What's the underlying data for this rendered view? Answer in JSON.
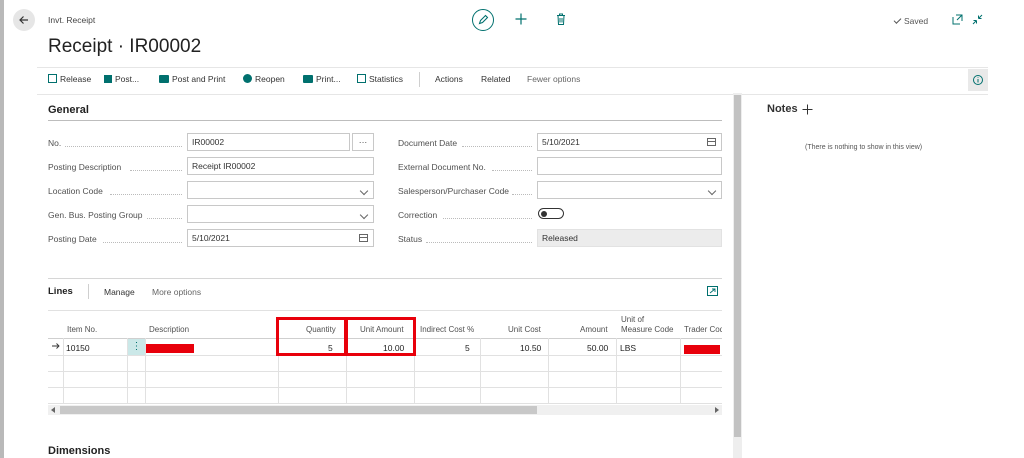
{
  "header": {
    "breadcrumb": "Invt. Receipt",
    "title": "Receipt · IR00002",
    "saved_label": "Saved"
  },
  "toolbar": {
    "items": [
      "Release",
      "Post...",
      "Post and Print",
      "Reopen",
      "Print...",
      "Statistics",
      "Actions",
      "Related",
      "Fewer options"
    ]
  },
  "general": {
    "title": "General",
    "no_label": "No.",
    "no_value": "IR00002",
    "posting_description_label": "Posting Description",
    "posting_description_value": "Receipt IR00002",
    "location_code_label": "Location Code",
    "location_code_value": "",
    "gen_bus_label": "Gen. Bus. Posting Group",
    "gen_bus_value": "",
    "posting_date_label": "Posting Date",
    "posting_date_value": "5/10/2021",
    "document_date_label": "Document Date",
    "document_date_value": "5/10/2021",
    "external_doc_label": "External Document No.",
    "external_doc_value": "",
    "salesperson_label": "Salesperson/Purchaser Code",
    "salesperson_value": "",
    "correction_label": "Correction",
    "status_label": "Status",
    "status_value": "Released"
  },
  "lines": {
    "title": "Lines",
    "manage": "Manage",
    "more_options": "More options",
    "columns": {
      "item_no": "Item No.",
      "description": "Description",
      "quantity": "Quantity",
      "unit_amount": "Unit Amount",
      "indirect_cost": "Indirect Cost %",
      "unit_cost": "Unit Cost",
      "amount": "Amount",
      "uom_line1": "Unit of",
      "uom_line2": "Measure Code",
      "trader_code": "Trader Code"
    },
    "row": {
      "item_no": "10150",
      "quantity": "5",
      "unit_amount": "10.00",
      "indirect_cost": "5",
      "unit_cost": "10.50",
      "amount": "50.00",
      "uom": "LBS"
    }
  },
  "dimensions": {
    "title": "Dimensions"
  },
  "notes": {
    "title": "Notes",
    "empty": "(There is nothing to show in this view)"
  },
  "colors": {
    "accent": "#00706e",
    "highlight": "#e8000b",
    "divider": "#d0d0d0"
  }
}
